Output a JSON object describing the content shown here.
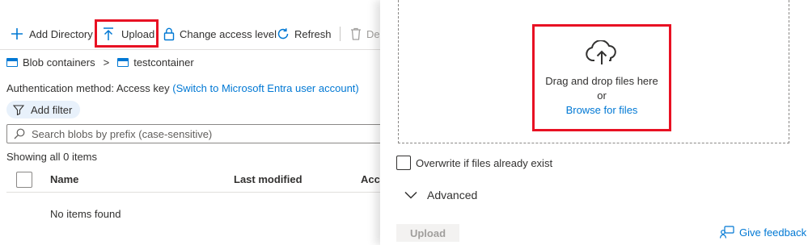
{
  "toolbar": {
    "add_directory": "Add Directory",
    "upload": "Upload",
    "change_access_level": "Change access level",
    "refresh": "Refresh",
    "delete": "De"
  },
  "breadcrumb": {
    "root": "Blob containers",
    "separator": ">",
    "current": "testcontainer"
  },
  "auth": {
    "label": "Authentication method:",
    "value": "Access key",
    "switch_link": "(Switch to Microsoft Entra user account)"
  },
  "filter": {
    "add_filter": "Add filter"
  },
  "search": {
    "placeholder": "Search blobs by prefix (case-sensitive)"
  },
  "list": {
    "showing": "Showing all 0 items",
    "columns": [
      "Name",
      "Last modified",
      "Acce"
    ],
    "empty": "No items found"
  },
  "upload_panel": {
    "drag_text": "Drag and drop files here",
    "or_text": "or",
    "browse_link": "Browse for files",
    "overwrite_label": "Overwrite if files already exist",
    "advanced_label": "Advanced",
    "upload_button": "Upload",
    "feedback_link": "Give feedback"
  },
  "colors": {
    "accent": "#0078d4",
    "highlight": "#e81123",
    "disabled_bg": "#f3f2f1",
    "disabled_text": "#a19f9d"
  }
}
